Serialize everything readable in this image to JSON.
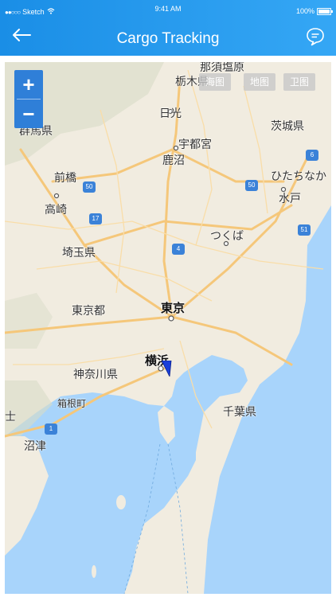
{
  "status": {
    "carrier": "Sketch",
    "time": "9:41 AM",
    "battery": "100%"
  },
  "header": {
    "title": "Cargo Tracking"
  },
  "map": {
    "zoom_in": "+",
    "zoom_out": "−",
    "types": [
      "海图",
      "地图",
      "卫图"
    ],
    "places": {
      "tokyo": "東京",
      "yokohama": "横浜",
      "tochigi": "栃木県",
      "nasushiobara": "那須塩原",
      "nikko": "日光",
      "utsunomiya": "宇都宮",
      "kanuma": "鹿沼",
      "gunma": "群馬県",
      "maebashi": "前橋",
      "takasaki": "高崎",
      "ibaraki": "茨城県",
      "hitachinaka": "ひたちなか",
      "mito": "水戸",
      "tsukuba": "つくば",
      "saitama": "埼玉県",
      "tokyo_pref": "東京都",
      "kanagawa": "神奈川県",
      "hakone": "箱根町",
      "numazu": "沼津",
      "chiba": "千葉県",
      "edge_shi": "士"
    },
    "routes": [
      "50",
      "17",
      "4",
      "50",
      "51",
      "6",
      "1"
    ]
  },
  "colors": {
    "header": "#1a8ee6",
    "sea": "#a8d4fb",
    "land": "#f1ece0",
    "road": "#f5c77a",
    "marker": "#1a3fd9"
  }
}
